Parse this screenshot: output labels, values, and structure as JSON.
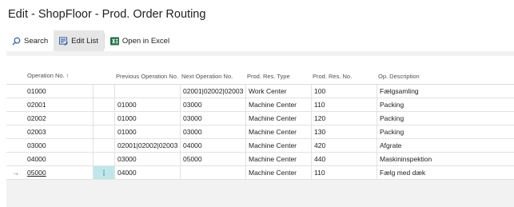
{
  "page": {
    "title": "Edit - ShopFloor - Prod. Order Routing"
  },
  "toolbar": {
    "search_label": "Search",
    "edit_list_label": "Edit List",
    "excel_label": "Open in Excel"
  },
  "columns": {
    "operation_no": "Operation No.",
    "sort_arrow": "↑",
    "previous_operation_no": "Previous Operation No.",
    "next_operation_no": "Next Operation No.",
    "prod_res_type": "Prod. Res. Type",
    "prod_res_no": "Prod. Res. No.",
    "op_description": "Op. Description"
  },
  "rows": [
    {
      "operation_no": "01000",
      "previous_operation_no": "",
      "next_operation_no": "02001|02002|02003",
      "prod_res_type": "Work Center",
      "prod_res_no": "100",
      "op_description": "Fælgsamling"
    },
    {
      "operation_no": "02001",
      "previous_operation_no": "01000",
      "next_operation_no": "03000",
      "prod_res_type": "Machine Center",
      "prod_res_no": "110",
      "op_description": "Packing"
    },
    {
      "operation_no": "02002",
      "previous_operation_no": "01000",
      "next_operation_no": "03000",
      "prod_res_type": "Machine Center",
      "prod_res_no": "120",
      "op_description": "Packing"
    },
    {
      "operation_no": "02003",
      "previous_operation_no": "01000",
      "next_operation_no": "03000",
      "prod_res_type": "Machine Center",
      "prod_res_no": "130",
      "op_description": "Packing"
    },
    {
      "operation_no": "03000",
      "previous_operation_no": "02001|02002|02003",
      "next_operation_no": "04000",
      "prod_res_type": "Machine Center",
      "prod_res_no": "420",
      "op_description": "Afgrate"
    },
    {
      "operation_no": "04000",
      "previous_operation_no": "03000",
      "next_operation_no": "05000",
      "prod_res_type": "Machine Center",
      "prod_res_no": "440",
      "op_description": "Maskininspektion"
    },
    {
      "operation_no": "05000",
      "previous_operation_no": "04000",
      "next_operation_no": "",
      "prod_res_type": "Machine Center",
      "prod_res_no": "110",
      "op_description": "Fælg med dæk"
    }
  ],
  "selected_row": {
    "arrow": "→",
    "action_glyph": "⋮"
  }
}
